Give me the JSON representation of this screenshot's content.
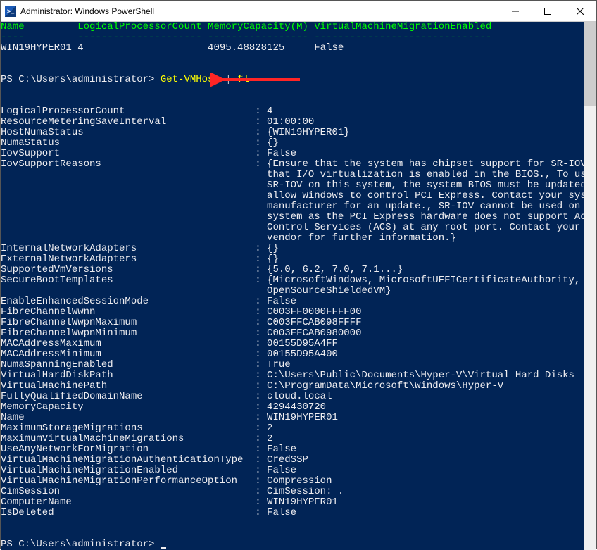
{
  "window": {
    "title": "Administrator: Windows PowerShell"
  },
  "table": {
    "headers": {
      "name": "Name",
      "lpc": "LogicalProcessorCount",
      "mem": "MemoryCapacity(M)",
      "vmme": "VirtualMachineMigrationEnabled"
    },
    "row": {
      "name": "WIN19HYPER01",
      "lpc": "4",
      "mem": "4095.48828125",
      "vmme": "False"
    }
  },
  "prompt1": {
    "path": "PS C:\\Users\\administrator> ",
    "cmd1": "Get-VMHost",
    "pipe": " | ",
    "cmd2": "fl"
  },
  "properties": [
    {
      "k": "LogicalProcessorCount",
      "v": "4"
    },
    {
      "k": "ResourceMeteringSaveInterval",
      "v": "01:00:00"
    },
    {
      "k": "HostNumaStatus",
      "v": "{WIN19HYPER01}"
    },
    {
      "k": "NumaStatus",
      "v": "{}"
    },
    {
      "k": "IovSupport",
      "v": "False"
    },
    {
      "k": "IovSupportReasons",
      "v": "{Ensure that the system has chipset support for SR-IOV and"
    },
    {
      "k": "",
      "v": "that I/O virtualization is enabled in the BIOS., To use"
    },
    {
      "k": "",
      "v": "SR-IOV on this system, the system BIOS must be updated to"
    },
    {
      "k": "",
      "v": "allow Windows to control PCI Express. Contact your system"
    },
    {
      "k": "",
      "v": "manufacturer for an update., SR-IOV cannot be used on this"
    },
    {
      "k": "",
      "v": "system as the PCI Express hardware does not support Access"
    },
    {
      "k": "",
      "v": "Control Services (ACS) at any root port. Contact your system"
    },
    {
      "k": "",
      "v": "vendor for further information.}"
    },
    {
      "k": "InternalNetworkAdapters",
      "v": "{}"
    },
    {
      "k": "ExternalNetworkAdapters",
      "v": "{}"
    },
    {
      "k": "SupportedVmVersions",
      "v": "{5.0, 6.2, 7.0, 7.1...}"
    },
    {
      "k": "SecureBootTemplates",
      "v": "{MicrosoftWindows, MicrosoftUEFICertificateAuthority,"
    },
    {
      "k": "",
      "v": "OpenSourceShieldedVM}"
    },
    {
      "k": "EnableEnhancedSessionMode",
      "v": "False"
    },
    {
      "k": "FibreChannelWwnn",
      "v": "C003FF0000FFFF00"
    },
    {
      "k": "FibreChannelWwpnMaximum",
      "v": "C003FFCAB098FFFF"
    },
    {
      "k": "FibreChannelWwpnMinimum",
      "v": "C003FFCAB0980000"
    },
    {
      "k": "MACAddressMaximum",
      "v": "00155D95A4FF"
    },
    {
      "k": "MACAddressMinimum",
      "v": "00155D95A400"
    },
    {
      "k": "NumaSpanningEnabled",
      "v": "True"
    },
    {
      "k": "VirtualHardDiskPath",
      "v": "C:\\Users\\Public\\Documents\\Hyper-V\\Virtual Hard Disks"
    },
    {
      "k": "VirtualMachinePath",
      "v": "C:\\ProgramData\\Microsoft\\Windows\\Hyper-V"
    },
    {
      "k": "FullyQualifiedDomainName",
      "v": "cloud.local"
    },
    {
      "k": "MemoryCapacity",
      "v": "4294430720"
    },
    {
      "k": "Name",
      "v": "WIN19HYPER01"
    },
    {
      "k": "MaximumStorageMigrations",
      "v": "2"
    },
    {
      "k": "MaximumVirtualMachineMigrations",
      "v": "2"
    },
    {
      "k": "UseAnyNetworkForMigration",
      "v": "False"
    },
    {
      "k": "VirtualMachineMigrationAuthenticationType",
      "v": "CredSSP"
    },
    {
      "k": "VirtualMachineMigrationEnabled",
      "v": "False"
    },
    {
      "k": "VirtualMachineMigrationPerformanceOption",
      "v": "Compression"
    },
    {
      "k": "CimSession",
      "v": "CimSession: ."
    },
    {
      "k": "ComputerName",
      "v": "WIN19HYPER01"
    },
    {
      "k": "IsDeleted",
      "v": "False"
    }
  ],
  "prompt2": {
    "path": "PS C:\\Users\\administrator> "
  },
  "layout": {
    "keyWidth": 42,
    "contIndent": 45
  }
}
